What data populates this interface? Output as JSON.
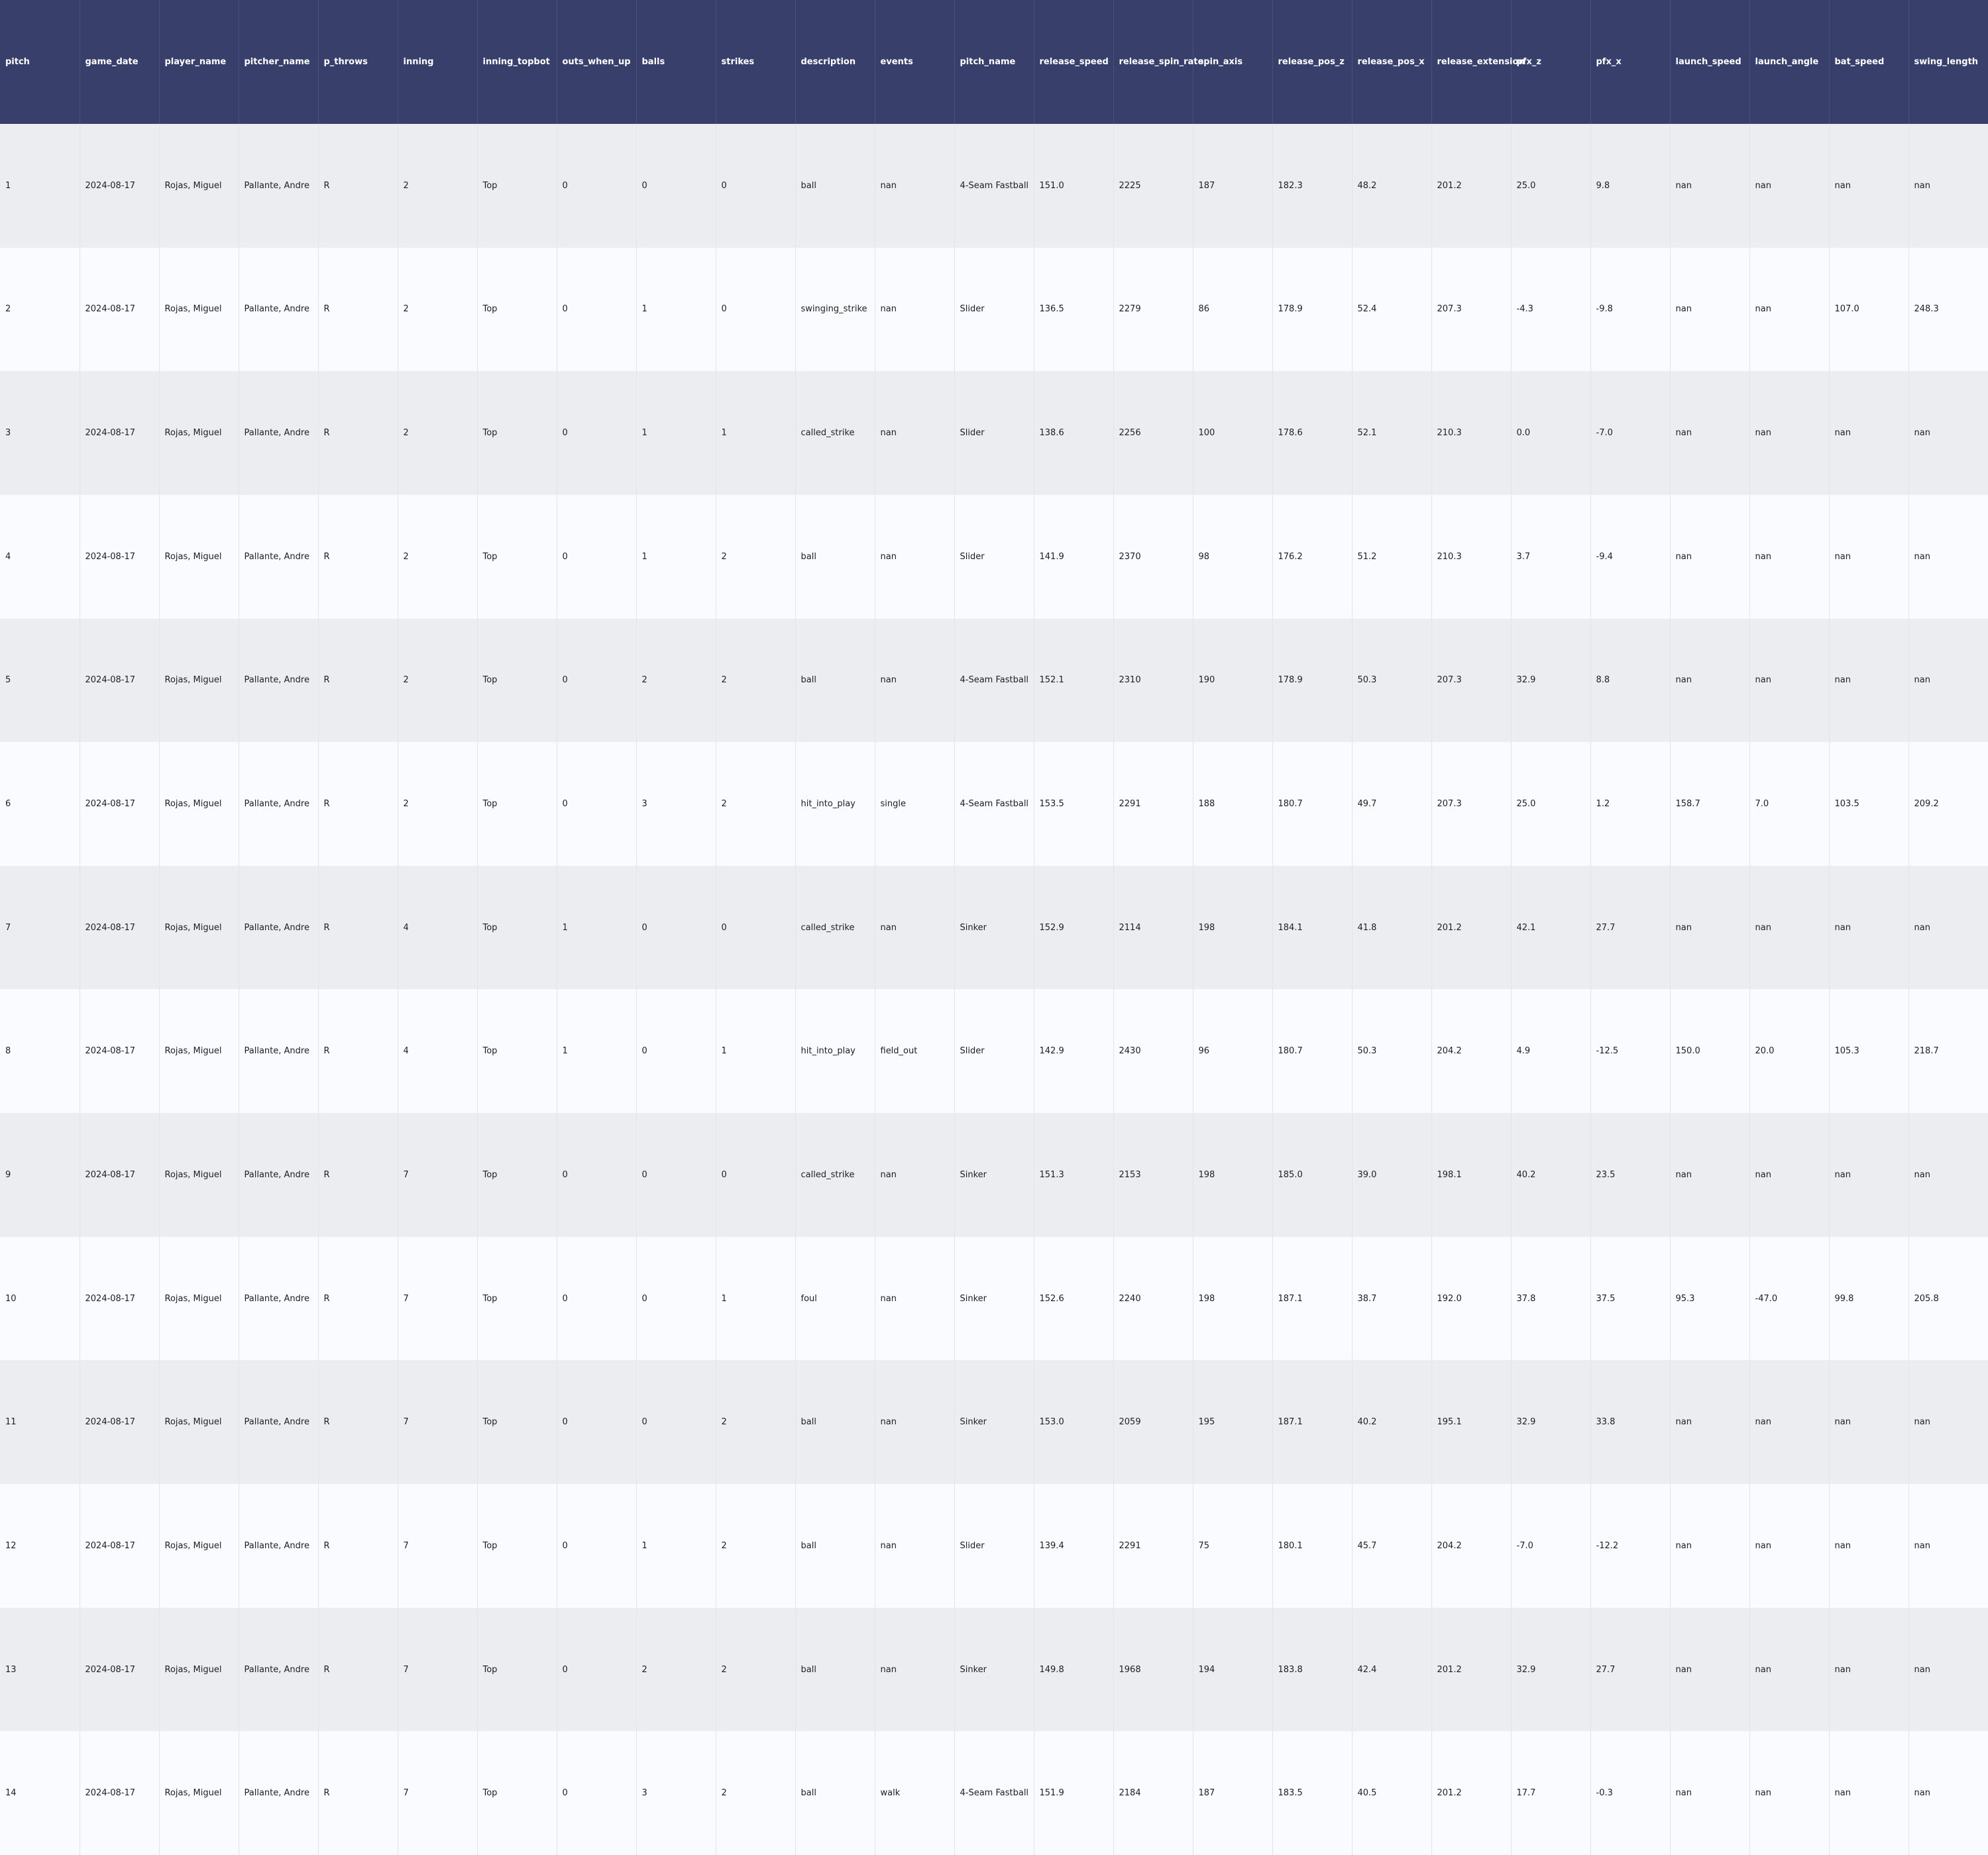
{
  "table": {
    "columns": [
      "pitch",
      "game_date",
      "player_name",
      "pitcher_name",
      "p_throws",
      "inning",
      "inning_topbot",
      "outs_when_up",
      "balls",
      "strikes",
      "description",
      "events",
      "pitch_name",
      "release_speed",
      "release_spin_rate",
      "spin_axis",
      "release_pos_z",
      "release_pos_x",
      "release_extension",
      "pfx_z",
      "pfx_x",
      "launch_speed",
      "launch_angle",
      "bat_speed",
      "swing_length"
    ],
    "rows": [
      [
        "1",
        "2024-08-17",
        "Rojas, Miguel",
        "Pallante, Andre",
        "R",
        "2",
        "Top",
        "0",
        "0",
        "0",
        "ball",
        "nan",
        "4-Seam Fastball",
        "151.0",
        "2225",
        "187",
        "182.3",
        "48.2",
        "201.2",
        "25.0",
        "9.8",
        "nan",
        "nan",
        "nan",
        "nan"
      ],
      [
        "2",
        "2024-08-17",
        "Rojas, Miguel",
        "Pallante, Andre",
        "R",
        "2",
        "Top",
        "0",
        "1",
        "0",
        "swinging_strike",
        "nan",
        "Slider",
        "136.5",
        "2279",
        "86",
        "178.9",
        "52.4",
        "207.3",
        "-4.3",
        "-9.8",
        "nan",
        "nan",
        "107.0",
        "248.3"
      ],
      [
        "3",
        "2024-08-17",
        "Rojas, Miguel",
        "Pallante, Andre",
        "R",
        "2",
        "Top",
        "0",
        "1",
        "1",
        "called_strike",
        "nan",
        "Slider",
        "138.6",
        "2256",
        "100",
        "178.6",
        "52.1",
        "210.3",
        "0.0",
        "-7.0",
        "nan",
        "nan",
        "nan",
        "nan"
      ],
      [
        "4",
        "2024-08-17",
        "Rojas, Miguel",
        "Pallante, Andre",
        "R",
        "2",
        "Top",
        "0",
        "1",
        "2",
        "ball",
        "nan",
        "Slider",
        "141.9",
        "2370",
        "98",
        "176.2",
        "51.2",
        "210.3",
        "3.7",
        "-9.4",
        "nan",
        "nan",
        "nan",
        "nan"
      ],
      [
        "5",
        "2024-08-17",
        "Rojas, Miguel",
        "Pallante, Andre",
        "R",
        "2",
        "Top",
        "0",
        "2",
        "2",
        "ball",
        "nan",
        "4-Seam Fastball",
        "152.1",
        "2310",
        "190",
        "178.9",
        "50.3",
        "207.3",
        "32.9",
        "8.8",
        "nan",
        "nan",
        "nan",
        "nan"
      ],
      [
        "6",
        "2024-08-17",
        "Rojas, Miguel",
        "Pallante, Andre",
        "R",
        "2",
        "Top",
        "0",
        "3",
        "2",
        "hit_into_play",
        "single",
        "4-Seam Fastball",
        "153.5",
        "2291",
        "188",
        "180.7",
        "49.7",
        "207.3",
        "25.0",
        "1.2",
        "158.7",
        "7.0",
        "103.5",
        "209.2"
      ],
      [
        "7",
        "2024-08-17",
        "Rojas, Miguel",
        "Pallante, Andre",
        "R",
        "4",
        "Top",
        "1",
        "0",
        "0",
        "called_strike",
        "nan",
        "Sinker",
        "152.9",
        "2114",
        "198",
        "184.1",
        "41.8",
        "201.2",
        "42.1",
        "27.7",
        "nan",
        "nan",
        "nan",
        "nan"
      ],
      [
        "8",
        "2024-08-17",
        "Rojas, Miguel",
        "Pallante, Andre",
        "R",
        "4",
        "Top",
        "1",
        "0",
        "1",
        "hit_into_play",
        "field_out",
        "Slider",
        "142.9",
        "2430",
        "96",
        "180.7",
        "50.3",
        "204.2",
        "4.9",
        "-12.5",
        "150.0",
        "20.0",
        "105.3",
        "218.7"
      ],
      [
        "9",
        "2024-08-17",
        "Rojas, Miguel",
        "Pallante, Andre",
        "R",
        "7",
        "Top",
        "0",
        "0",
        "0",
        "called_strike",
        "nan",
        "Sinker",
        "151.3",
        "2153",
        "198",
        "185.0",
        "39.0",
        "198.1",
        "40.2",
        "23.5",
        "nan",
        "nan",
        "nan",
        "nan"
      ],
      [
        "10",
        "2024-08-17",
        "Rojas, Miguel",
        "Pallante, Andre",
        "R",
        "7",
        "Top",
        "0",
        "0",
        "1",
        "foul",
        "nan",
        "Sinker",
        "152.6",
        "2240",
        "198",
        "187.1",
        "38.7",
        "192.0",
        "37.8",
        "37.5",
        "95.3",
        "-47.0",
        "99.8",
        "205.8"
      ],
      [
        "11",
        "2024-08-17",
        "Rojas, Miguel",
        "Pallante, Andre",
        "R",
        "7",
        "Top",
        "0",
        "0",
        "2",
        "ball",
        "nan",
        "Sinker",
        "153.0",
        "2059",
        "195",
        "187.1",
        "40.2",
        "195.1",
        "32.9",
        "33.8",
        "nan",
        "nan",
        "nan",
        "nan"
      ],
      [
        "12",
        "2024-08-17",
        "Rojas, Miguel",
        "Pallante, Andre",
        "R",
        "7",
        "Top",
        "0",
        "1",
        "2",
        "ball",
        "nan",
        "Slider",
        "139.4",
        "2291",
        "75",
        "180.1",
        "45.7",
        "204.2",
        "-7.0",
        "-12.2",
        "nan",
        "nan",
        "nan",
        "nan"
      ],
      [
        "13",
        "2024-08-17",
        "Rojas, Miguel",
        "Pallante, Andre",
        "R",
        "7",
        "Top",
        "0",
        "2",
        "2",
        "ball",
        "nan",
        "Sinker",
        "149.8",
        "1968",
        "194",
        "183.8",
        "42.4",
        "201.2",
        "32.9",
        "27.7",
        "nan",
        "nan",
        "nan",
        "nan"
      ],
      [
        "14",
        "2024-08-17",
        "Rojas, Miguel",
        "Pallante, Andre",
        "R",
        "7",
        "Top",
        "0",
        "3",
        "2",
        "ball",
        "walk",
        "4-Seam Fastball",
        "151.9",
        "2184",
        "187",
        "183.5",
        "40.5",
        "201.2",
        "17.7",
        "-0.3",
        "nan",
        "nan",
        "nan",
        "nan"
      ]
    ]
  },
  "colors": {
    "header_bg": "#383f6b",
    "header_text": "#ffffff",
    "row_odd": "#ecedf0",
    "row_even": "#fafbfe"
  }
}
